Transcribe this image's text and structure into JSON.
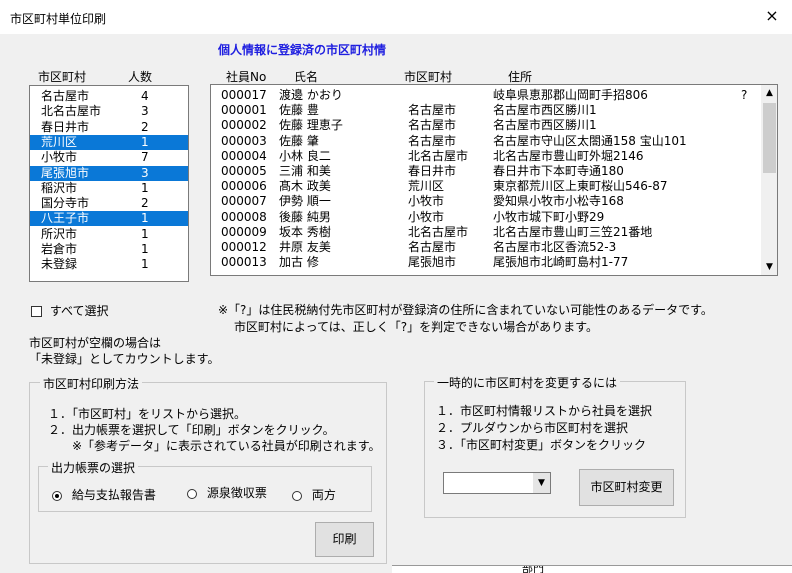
{
  "window": {
    "title": "市区町村単位印刷",
    "close_icon": "×"
  },
  "heading": "個人情報に登録済の市区町村情",
  "city_list": {
    "col_city": "市区町村",
    "col_count": "人数",
    "rows": [
      {
        "city": "名古屋市",
        "count": "4",
        "selected": false
      },
      {
        "city": "北名古屋市",
        "count": "3",
        "selected": false
      },
      {
        "city": "春日井市",
        "count": "2",
        "selected": false
      },
      {
        "city": "荒川区",
        "count": "1",
        "selected": true
      },
      {
        "city": "小牧市",
        "count": "7",
        "selected": false
      },
      {
        "city": "尾張旭市",
        "count": "3",
        "selected": true
      },
      {
        "city": "稲沢市",
        "count": "1",
        "selected": false
      },
      {
        "city": "国分寺市",
        "count": "2",
        "selected": false
      },
      {
        "city": "八王子市",
        "count": "1",
        "selected": true
      },
      {
        "city": "所沢市",
        "count": "1",
        "selected": false
      },
      {
        "city": "岩倉市",
        "count": "1",
        "selected": false
      },
      {
        "city": "未登録",
        "count": "1",
        "selected": false
      }
    ]
  },
  "employee_list": {
    "col_no": "社員No",
    "col_name": "氏名",
    "col_city": "市区町村",
    "col_address": "住所",
    "rows": [
      {
        "no": "000017",
        "name": "渡邊 かおり",
        "city": "",
        "address": "岐阜県恵那郡山岡町手招806",
        "flag": "?"
      },
      {
        "no": "000001",
        "name": "佐藤 豊",
        "city": "名古屋市",
        "address": "名古屋市西区勝川1",
        "flag": ""
      },
      {
        "no": "000002",
        "name": "佐藤 理恵子",
        "city": "名古屋市",
        "address": "名古屋市西区勝川1",
        "flag": ""
      },
      {
        "no": "000003",
        "name": "佐藤 肇",
        "city": "名古屋市",
        "address": "名古屋市守山区太閤通158 宝山101",
        "flag": ""
      },
      {
        "no": "000004",
        "name": "小林 良二",
        "city": "北名古屋市",
        "address": "北名古屋市豊山町外堀2146",
        "flag": ""
      },
      {
        "no": "000005",
        "name": "三浦 和美",
        "city": "春日井市",
        "address": "春日井市下本町寺通180",
        "flag": ""
      },
      {
        "no": "000006",
        "name": "髙木 政美",
        "city": "荒川区",
        "address": "東京都荒川区上東町桜山546-87",
        "flag": ""
      },
      {
        "no": "000007",
        "name": "伊勢 順一",
        "city": "小牧市",
        "address": "愛知県小牧市小松寺168",
        "flag": ""
      },
      {
        "no": "000008",
        "name": "後藤 純男",
        "city": "小牧市",
        "address": "小牧市城下町小野29",
        "flag": ""
      },
      {
        "no": "000009",
        "name": "坂本 秀樹",
        "city": "北名古屋市",
        "address": "北名古屋市豊山町三笠21番地",
        "flag": ""
      },
      {
        "no": "000012",
        "name": "井原 友美",
        "city": "名古屋市",
        "address": "名古屋市北区香流52-3",
        "flag": ""
      },
      {
        "no": "000013",
        "name": "加古 修",
        "city": "尾張旭市",
        "address": "尾張旭市北崎町島村1-77",
        "flag": ""
      }
    ]
  },
  "select_all_label": "すべて選択",
  "note1": "※「?」は住民税納付先市区町村が登録済の住所に含まれていない可能性のあるデータです。",
  "note2": "市区町村によっては、正しく「?」を判定できない場合があります。",
  "blank_note1": "市区町村が空欄の場合は",
  "blank_note2": "「未登録」としてカウントします。",
  "print_method": {
    "legend": "市区町村印刷方法",
    "step1": "１．「市区町村」をリストから選択。",
    "step2": "２．出力帳票を選択して「印刷」ボタンをクリック。",
    "step3": "※「参考データ」に表示されている社員が印刷されます。"
  },
  "output_select": {
    "legend": "出力帳票の選択",
    "options": [
      "給与支払報告書",
      "源泉徴収票",
      "両方"
    ],
    "selected_index": 0
  },
  "print_button": "印刷",
  "temp_change": {
    "legend": "一時的に市区町村を変更するには",
    "step1": "１．市区町村情報リストから社員を選択",
    "step2": "２．プルダウンから市区町村を選択",
    "step3": "３．「市区町村変更」ボタンをクリック",
    "dropdown_value": "",
    "button": "市区町村変更"
  },
  "background_text": "部門"
}
